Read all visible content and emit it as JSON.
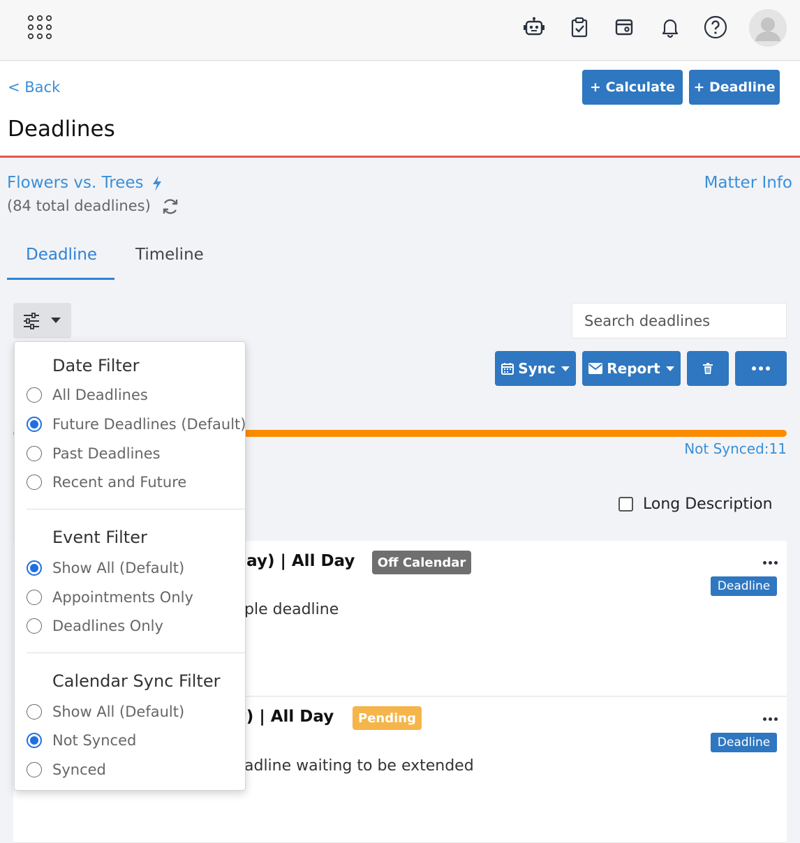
{
  "topbar": {
    "icons": [
      "apps-icon",
      "robot-icon",
      "clipboard-check-icon",
      "wallet-icon",
      "bell-icon",
      "help-icon",
      "user-avatar"
    ]
  },
  "header": {
    "back_label": "< Back",
    "title": "Deadlines",
    "calculate_label": "+ Calculate",
    "deadline_label": "+ Deadline"
  },
  "matter": {
    "name": "Flowers vs. Trees",
    "total": "(84 total deadlines)",
    "info_label": "Matter Info"
  },
  "tabs": [
    {
      "label": "Deadline",
      "active": true
    },
    {
      "label": "Timeline",
      "active": false
    }
  ],
  "search": {
    "placeholder": "Search deadlines"
  },
  "actions": {
    "sync_label": "Sync",
    "report_label": "Report"
  },
  "progress": {
    "fraction": 1.0,
    "color": "#fb8c00",
    "not_synced_label": "Not Synced:11"
  },
  "long_description": {
    "label": "Long Description",
    "checked": false
  },
  "cards": [
    {
      "title_visible": "sday)  |  All Day",
      "status_badge": "Off Calendar",
      "type_badge": "Deadline",
      "description_visible": "ple deadline"
    },
    {
      "title_visible": "ay)  |  All Day",
      "status_badge": "Pending",
      "type_badge": "Deadline",
      "description_visible": "adline waiting to be extended"
    }
  ],
  "filters": {
    "date": {
      "title": "Date Filter",
      "options": [
        "All Deadlines",
        "Future Deadlines (Default)",
        "Past Deadlines",
        "Recent and Future"
      ],
      "selected": 1
    },
    "event": {
      "title": "Event Filter",
      "options": [
        "Show All (Default)",
        "Appointments Only",
        "Deadlines Only"
      ],
      "selected": 0
    },
    "sync": {
      "title": "Calendar Sync Filter",
      "options": [
        "Show All (Default)",
        "Not Synced",
        "Synced"
      ],
      "selected": 1
    }
  },
  "colors": {
    "primary": "#2f77c0",
    "link": "#3a8fd8",
    "header_border": "#e4574b",
    "off_calendar": "#6f6f6f",
    "pending": "#f5b54a"
  }
}
